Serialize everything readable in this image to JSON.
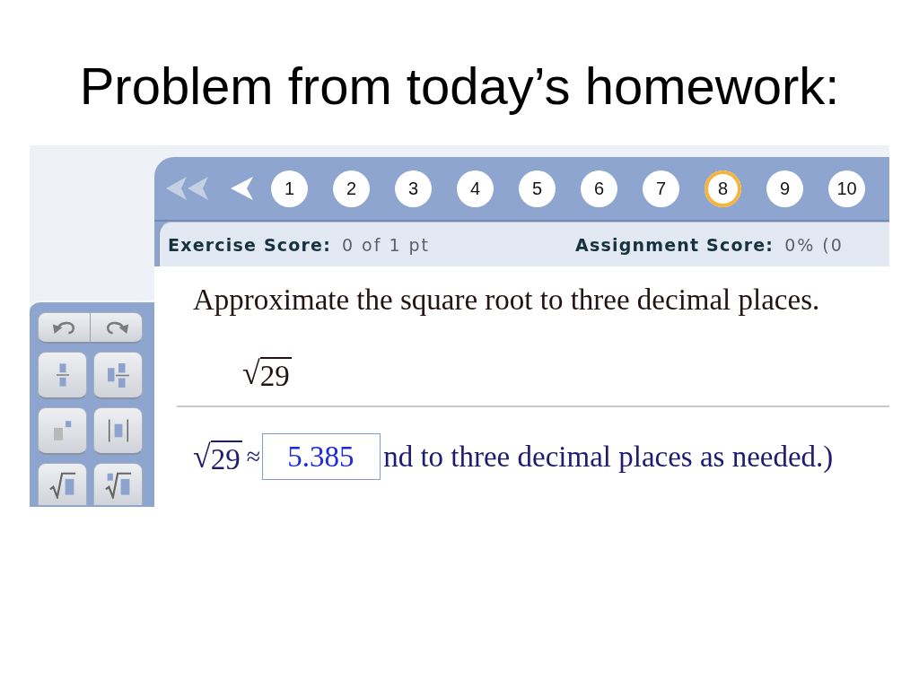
{
  "slide": {
    "title": "Problem from today’s homework:"
  },
  "nav": {
    "arrows": [
      {
        "kind": "first",
        "disabled": true
      },
      {
        "kind": "previous",
        "disabled": false
      }
    ],
    "questions": [
      {
        "label": "1",
        "selected": false
      },
      {
        "label": "2",
        "selected": false
      },
      {
        "label": "3",
        "selected": false
      },
      {
        "label": "4",
        "selected": false
      },
      {
        "label": "5",
        "selected": false
      },
      {
        "label": "6",
        "selected": false
      },
      {
        "label": "7",
        "selected": false
      },
      {
        "label": "8",
        "selected": true
      },
      {
        "label": "9",
        "selected": false
      },
      {
        "label": "10",
        "selected": false
      }
    ]
  },
  "scores": [
    {
      "label": "Exercise Score:",
      "value": "0 of 1 pt"
    },
    {
      "label": "Assignment Score:",
      "value": "0% (0"
    }
  ],
  "palette": {
    "buttons": [
      {
        "kind": "undo"
      },
      {
        "kind": "redo"
      },
      {
        "kind": "fraction"
      },
      {
        "kind": "mixed-number"
      },
      {
        "kind": "exponent"
      },
      {
        "kind": "absolute-value"
      },
      {
        "kind": "square-root"
      },
      {
        "kind": "nth-root"
      }
    ]
  },
  "question": {
    "prompt": "Approximate the square root to three decimal places.",
    "expression": {
      "radical": "√",
      "radicand": "29"
    }
  },
  "answer": {
    "expression": {
      "radical": "√",
      "radicand": "29"
    },
    "relation": "≈",
    "value": "5.385",
    "instruction": "nd to three decimal places as needed.)"
  }
}
